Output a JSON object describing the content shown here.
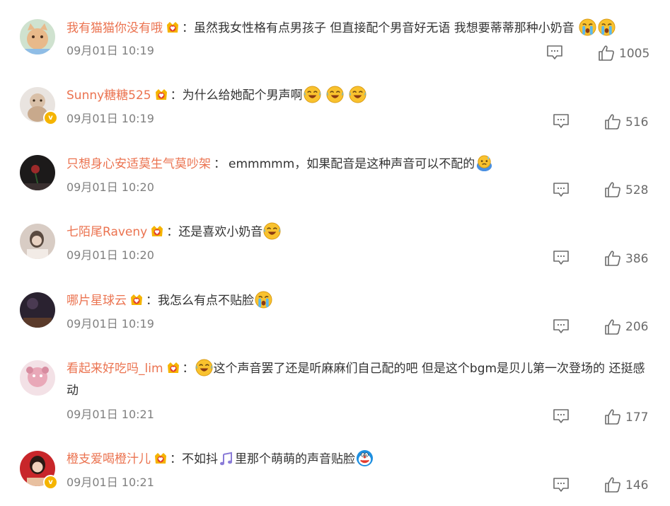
{
  "comments": [
    {
      "username": "我有猫猫你没有哦",
      "text": "虽然我女性格有点男孩子 但直接配个男音好无语 我想要蒂蒂那种小奶音",
      "emojis": [
        "crying-emoji",
        "crying-emoji"
      ],
      "time": "09月01日 10:19",
      "likes": "1005"
    },
    {
      "username": "Sunny糖糖525",
      "text": "为什么给她配个男声啊",
      "emojis": [
        "laugh-cry-emoji",
        "laugh-cry-emoji",
        "laugh-cry-emoji"
      ],
      "time": "09月01日 10:19",
      "likes": "516"
    },
    {
      "username": "只想身心安适莫生气莫吵架",
      "text": "emmmmm，如果配音是这种声音可以不配的",
      "emojis": [
        "sweat-emoji"
      ],
      "time": "09月01日 10:20",
      "likes": "528"
    },
    {
      "username": "七陌尾Raveny",
      "text": "还是喜欢小奶音",
      "emojis": [
        "laugh-cry-emoji"
      ],
      "time": "09月01日 10:20",
      "likes": "386"
    },
    {
      "username": "哪片星球云",
      "text": "我怎么有点不贴脸",
      "emojis": [
        "crying-emoji"
      ],
      "time": "09月01日 10:19",
      "likes": "206"
    },
    {
      "username": "看起来好吃吗_lim",
      "text_after_emoji": "这个声音罢了还是听麻麻们自己配的吧 但是这个bgm是贝儿第一次登场的 还挺感动",
      "emojis": [
        "laugh-cry-emoji"
      ],
      "time": "09月01日 10:21",
      "likes": "177"
    },
    {
      "username": "橙支爱喝橙汁儿",
      "text_before": "不如抖",
      "text_after": "里那个萌萌的声音贴脸",
      "emojis": [
        "music-note-icon",
        "doraemon-emoji"
      ],
      "time": "09月01日 10:21",
      "likes": "146"
    }
  ],
  "colon": "：",
  "colors": {
    "username": "#eb7350",
    "text": "#333333",
    "time": "#808080",
    "icon": "#6b6b6b",
    "badge": "#f5b400"
  }
}
